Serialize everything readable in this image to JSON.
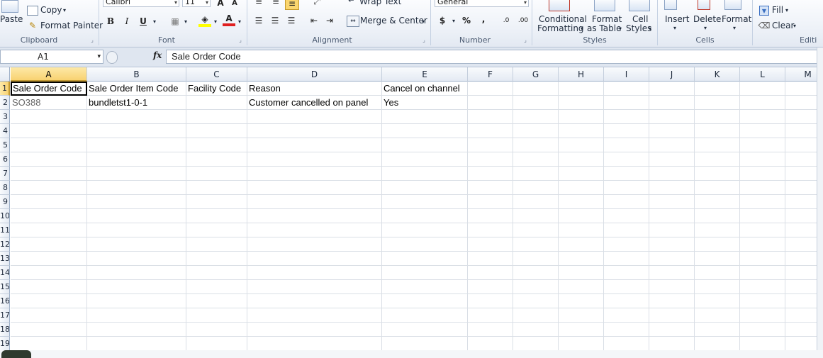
{
  "ribbon": {
    "clipboard": {
      "paste": "Paste",
      "copy": "Copy",
      "format_painter": "Format Painter",
      "label": "Clipboard"
    },
    "font": {
      "name": "Calibri",
      "size": "11",
      "bold": "B",
      "italic": "I",
      "underline": "U",
      "font_color_glyph": "A",
      "label": "Font"
    },
    "alignment": {
      "wrap_text": "Wrap Text",
      "merge_center": "Merge & Center",
      "label": "Alignment"
    },
    "number": {
      "format": "General",
      "currency": "$",
      "percent": "%",
      "comma": ",",
      "inc_decimal": ".0",
      "dec_decimal": ".00",
      "label": "Number"
    },
    "styles": {
      "conditional": "Conditional",
      "conditional2": "Formatting",
      "format_as": "Format",
      "format_as2": "as Table",
      "cell": "Cell",
      "cell2": "Styles",
      "label": "Styles"
    },
    "cells": {
      "insert": "Insert",
      "delete": "Delete",
      "format": "Format",
      "label": "Cells"
    },
    "editing": {
      "fill": "Fill",
      "clear": "Clear",
      "label": "Editi"
    }
  },
  "formula_bar": {
    "name_box": "A1",
    "fx": "fx",
    "content": "Sale Order Code"
  },
  "columns": [
    "A",
    "B",
    "C",
    "D",
    "E",
    "F",
    "G",
    "H",
    "I",
    "J",
    "K",
    "L",
    "M"
  ],
  "rows": [
    "1",
    "2",
    "3",
    "4",
    "5",
    "6",
    "7",
    "8",
    "9",
    "10",
    "11",
    "12",
    "13",
    "14",
    "15",
    "16",
    "17",
    "18",
    "19"
  ],
  "cells": {
    "r1": [
      "Sale Order Code",
      "Sale Order Item Code",
      "Facility Code",
      "Reason",
      "Cancel on channel"
    ],
    "r2": [
      "SO388",
      "bundletst1-0-1",
      "",
      "Customer cancelled on panel",
      "Yes"
    ]
  },
  "colors": {
    "selected_header": "#f8d271",
    "ribbon_bg": "#eef2f8",
    "gridline": "#dadfe6"
  }
}
